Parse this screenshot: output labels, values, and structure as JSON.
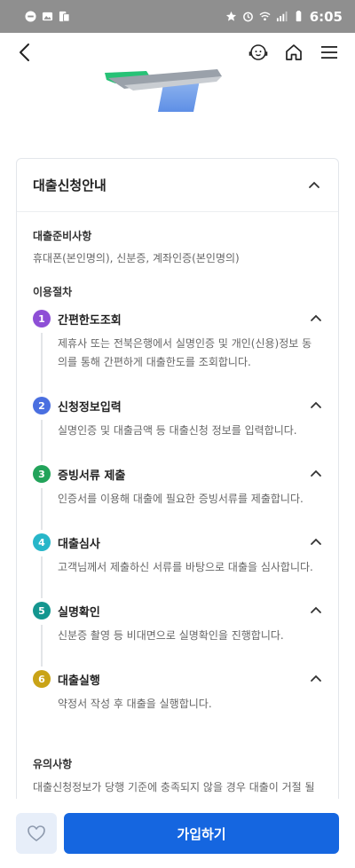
{
  "status_bar": {
    "time": "6:05",
    "left_icons": [
      "minus-circle-icon",
      "image-icon",
      "app-icon"
    ],
    "right_icons": [
      "star-icon",
      "alarm-icon",
      "wifi-icon",
      "signal-icon",
      "battery-icon"
    ]
  },
  "nav": {
    "back_icon": "chevron-left-icon",
    "chatbot_icon": "chatbot-icon",
    "home_icon": "home-icon",
    "menu_icon": "hamburger-menu-icon"
  },
  "hero": {
    "image": "hero-illustration"
  },
  "guide": {
    "title": "대출신청안내",
    "prep_label": "대출준비사항",
    "prep_text": "휴대폰(본인명의), 신분증, 계좌인증(본인명의)",
    "procedure_label": "이용절차",
    "steps": [
      {
        "num": "1",
        "title": "간편한도조회",
        "desc": "제휴사 또는 전북은행에서 실명인증 및 개인(신용)정보 동의를 통해 간편하게 대출한도를 조회합니다.",
        "color": "#8e4fd6"
      },
      {
        "num": "2",
        "title": "신청정보입력",
        "desc": "실명인증 및 대출금액 등 대출신청 정보를 입력합니다.",
        "color": "#4a6fe0"
      },
      {
        "num": "3",
        "title": "증빙서류 제출",
        "desc": "인증서를 이용해 대출에 필요한 증빙서류를 제출합니다.",
        "color": "#22a35a"
      },
      {
        "num": "4",
        "title": "대출심사",
        "desc": "고객님께서 제출하신 서류를 바탕으로 대출을 심사합니다.",
        "color": "#27b6c9"
      },
      {
        "num": "5",
        "title": "실명확인",
        "desc": "신분증 촬영 등 비대면으로 실명확인을 진행합니다.",
        "color": "#14968f"
      },
      {
        "num": "6",
        "title": "대출실행",
        "desc": "약정서 작성 후 대출을 실행합니다.",
        "color": "#c9a317"
      }
    ],
    "notice_label": "유의사항",
    "notice_text": "대출신청정보가 당행 기준에 충족되지 않을 경우 대출이 거절 될 수 있습니다."
  },
  "bottom": {
    "favorite_icon": "heart-icon",
    "join_label": "가입하기",
    "join_color": "#1566e0"
  }
}
